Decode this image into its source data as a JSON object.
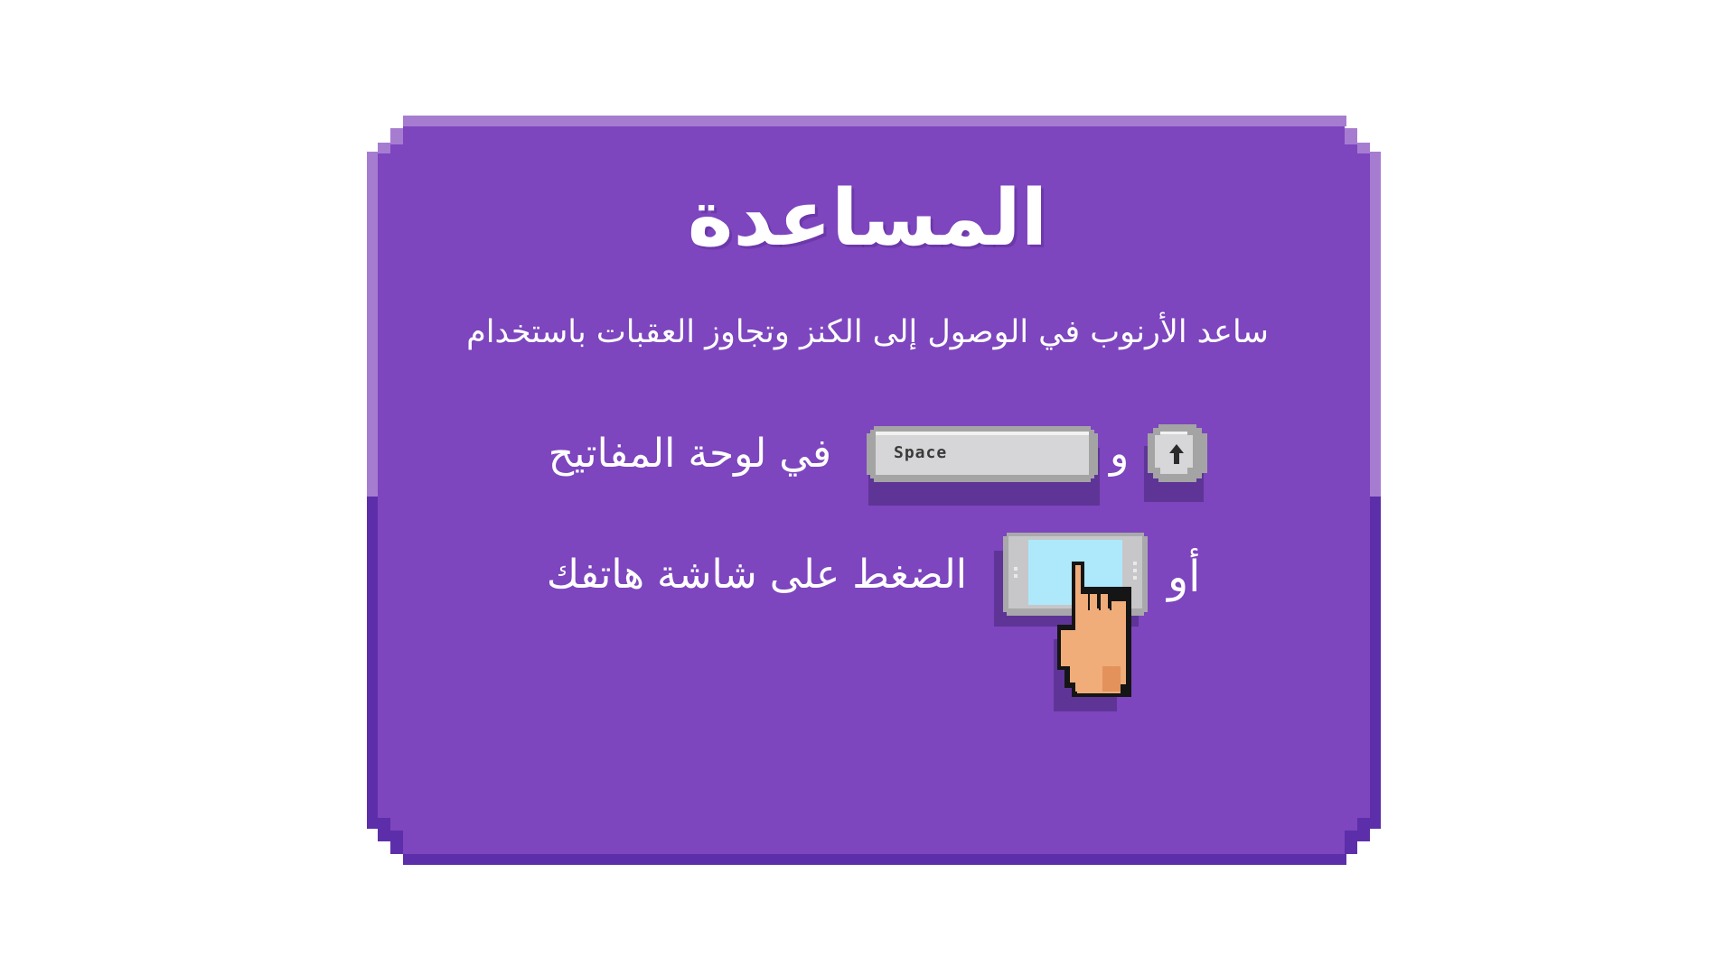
{
  "help": {
    "title": "المساعدة",
    "description": "ساعد الأرنوب في الوصول إلى الكنز وتجاوز العقبات باستخدام",
    "keyboard_line": {
      "and": "و",
      "text": "في لوحة المفاتيح",
      "space_key_label": "Space",
      "up_key_icon": "arrow-up-icon"
    },
    "touch_line": {
      "or": "أو",
      "text": "الضغط على شاشة هاتفك",
      "icon": "phone-tap-icon"
    }
  },
  "colors": {
    "panel_fill": "#7d45be",
    "panel_border_light": "#a67cd1",
    "panel_border_dark": "#5d2ea9",
    "text": "#ffffff",
    "key": "#d6d6d8",
    "screen": "#aee8fb",
    "skin": "#f0ad7a"
  }
}
